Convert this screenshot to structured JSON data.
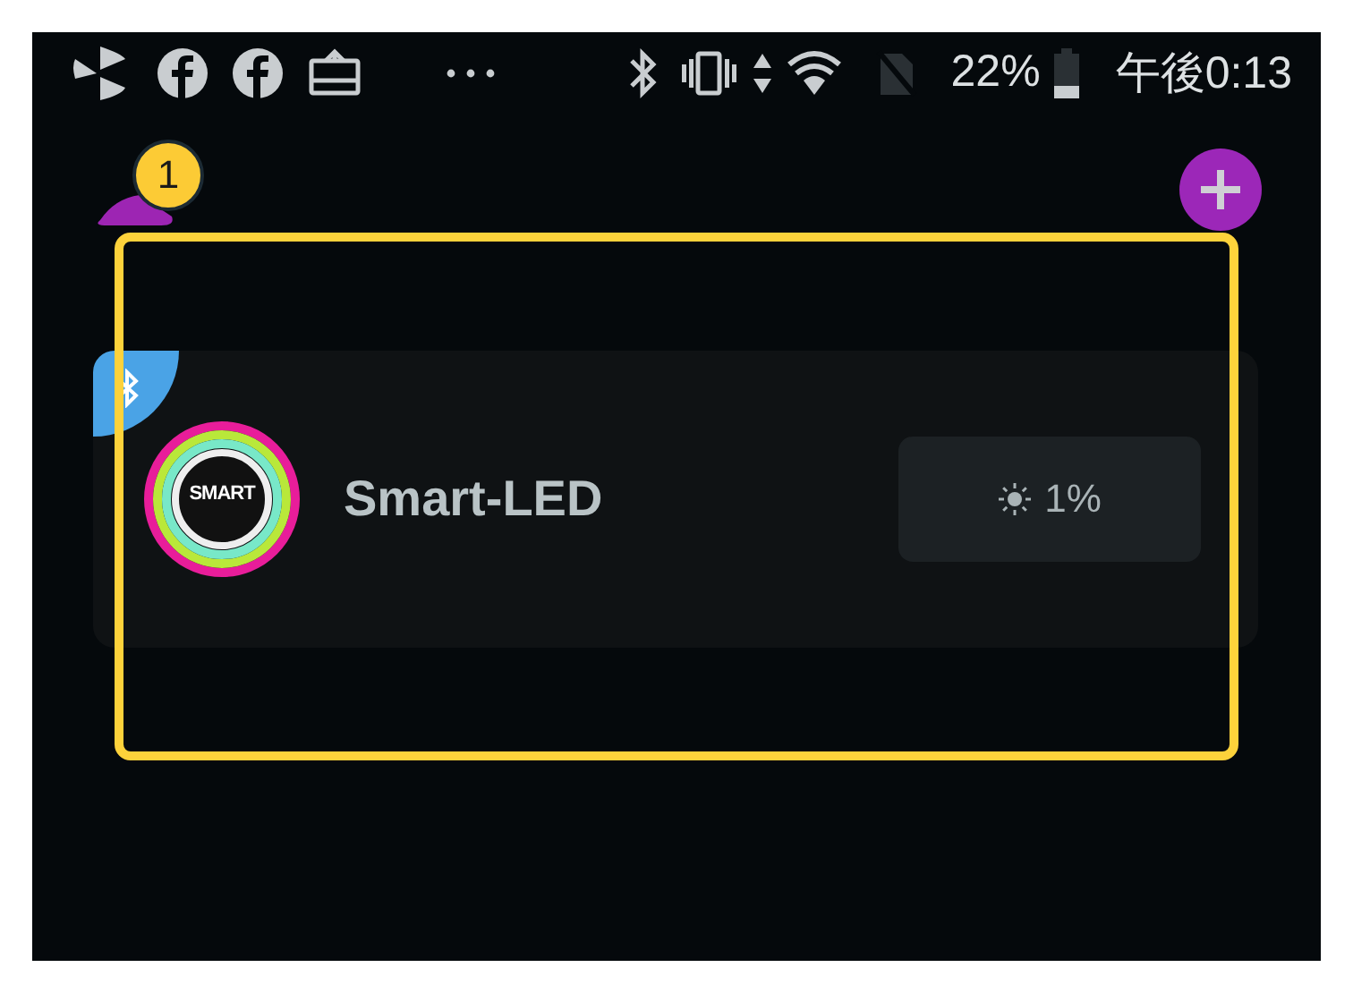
{
  "status_bar": {
    "battery": "22%",
    "time": "午後0:13"
  },
  "annotation": {
    "label": "1"
  },
  "devices": [
    {
      "name": "Smart-LED",
      "logo_text": "SMART",
      "bluetooth": true,
      "brightness": "1%"
    }
  ]
}
